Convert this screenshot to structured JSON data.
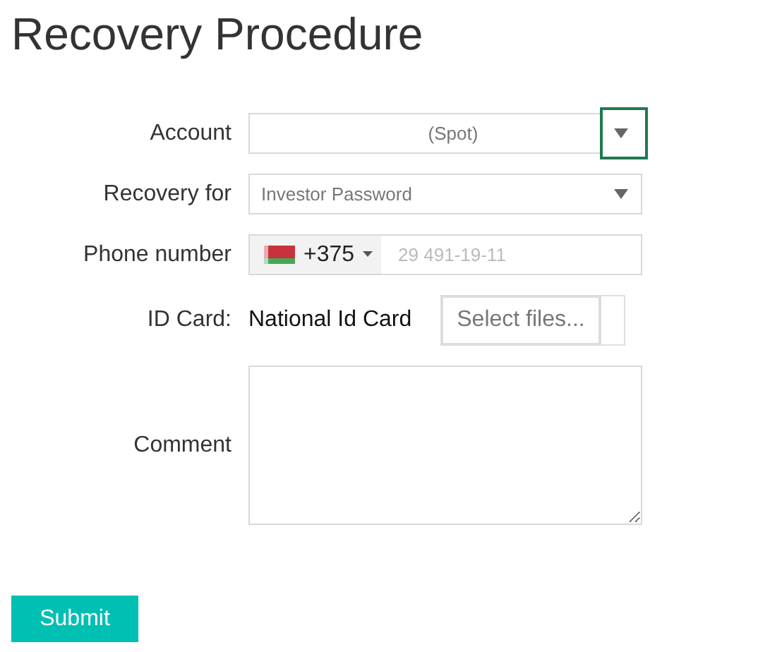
{
  "title": "Recovery Procedure",
  "fields": [
    {
      "kind": "select",
      "label": "Account",
      "value": "(Spot)",
      "centered": true,
      "arrow_focused": true
    },
    {
      "kind": "select",
      "label": "Recovery for",
      "value": "Investor Password",
      "centered": false,
      "arrow_focused": false
    },
    {
      "kind": "phone",
      "label": "Phone number",
      "code": "+375",
      "placeholder": "29 491-19-11"
    },
    {
      "kind": "file",
      "label": "ID Card:",
      "document": "National Id Card",
      "button": "Select files..."
    },
    {
      "kind": "textarea",
      "label": "Comment"
    }
  ],
  "submit": "Submit"
}
